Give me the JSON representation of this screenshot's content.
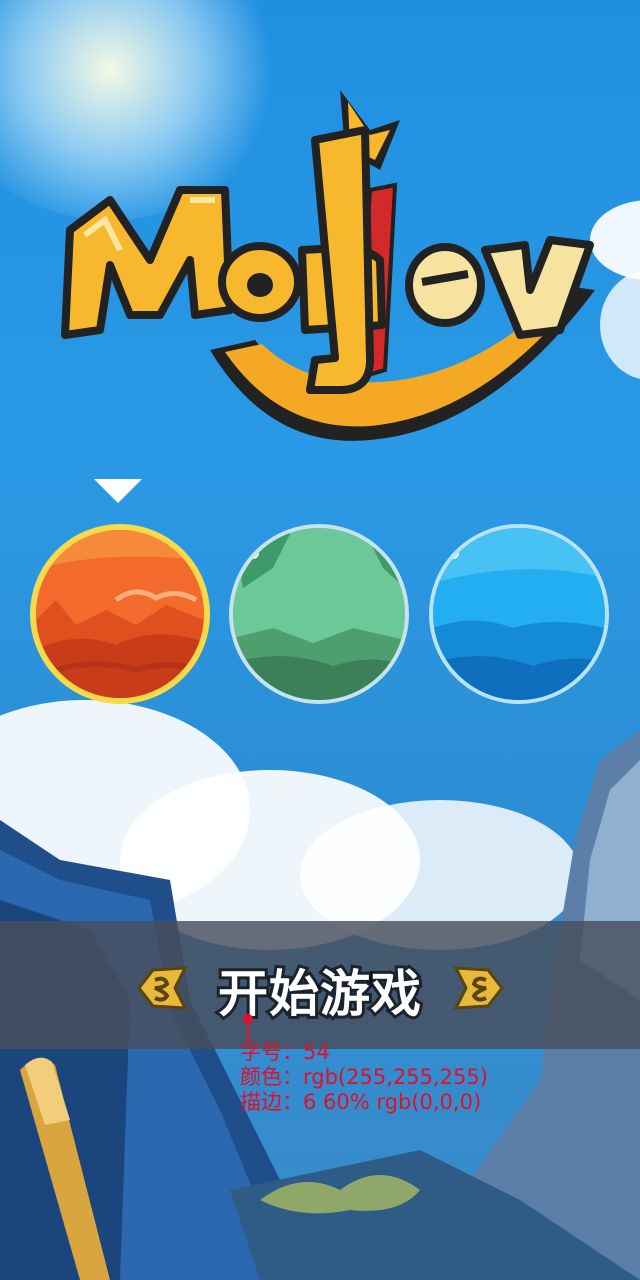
{
  "logo": {
    "text": "Monkey"
  },
  "levels": [
    {
      "name": "fire-world",
      "locked": false,
      "selected": true,
      "color": "#f0642a"
    },
    {
      "name": "forest-world",
      "locked": true,
      "selected": false,
      "color": "#68c490"
    },
    {
      "name": "ocean-world",
      "locked": true,
      "selected": false,
      "color": "#1ea8ee"
    }
  ],
  "start_button": {
    "label": "开始游戏"
  },
  "annotation": {
    "font_size": "字号：54",
    "color": "颜色：rgb(255,255,255)",
    "stroke": "描边：6 60% rgb(0,0,0)"
  },
  "colors": {
    "sky": "#2a9ae6",
    "accent_gold": "#f7b82e",
    "ring_selected": "#f7d94a",
    "annotation_red": "#e0102a"
  }
}
